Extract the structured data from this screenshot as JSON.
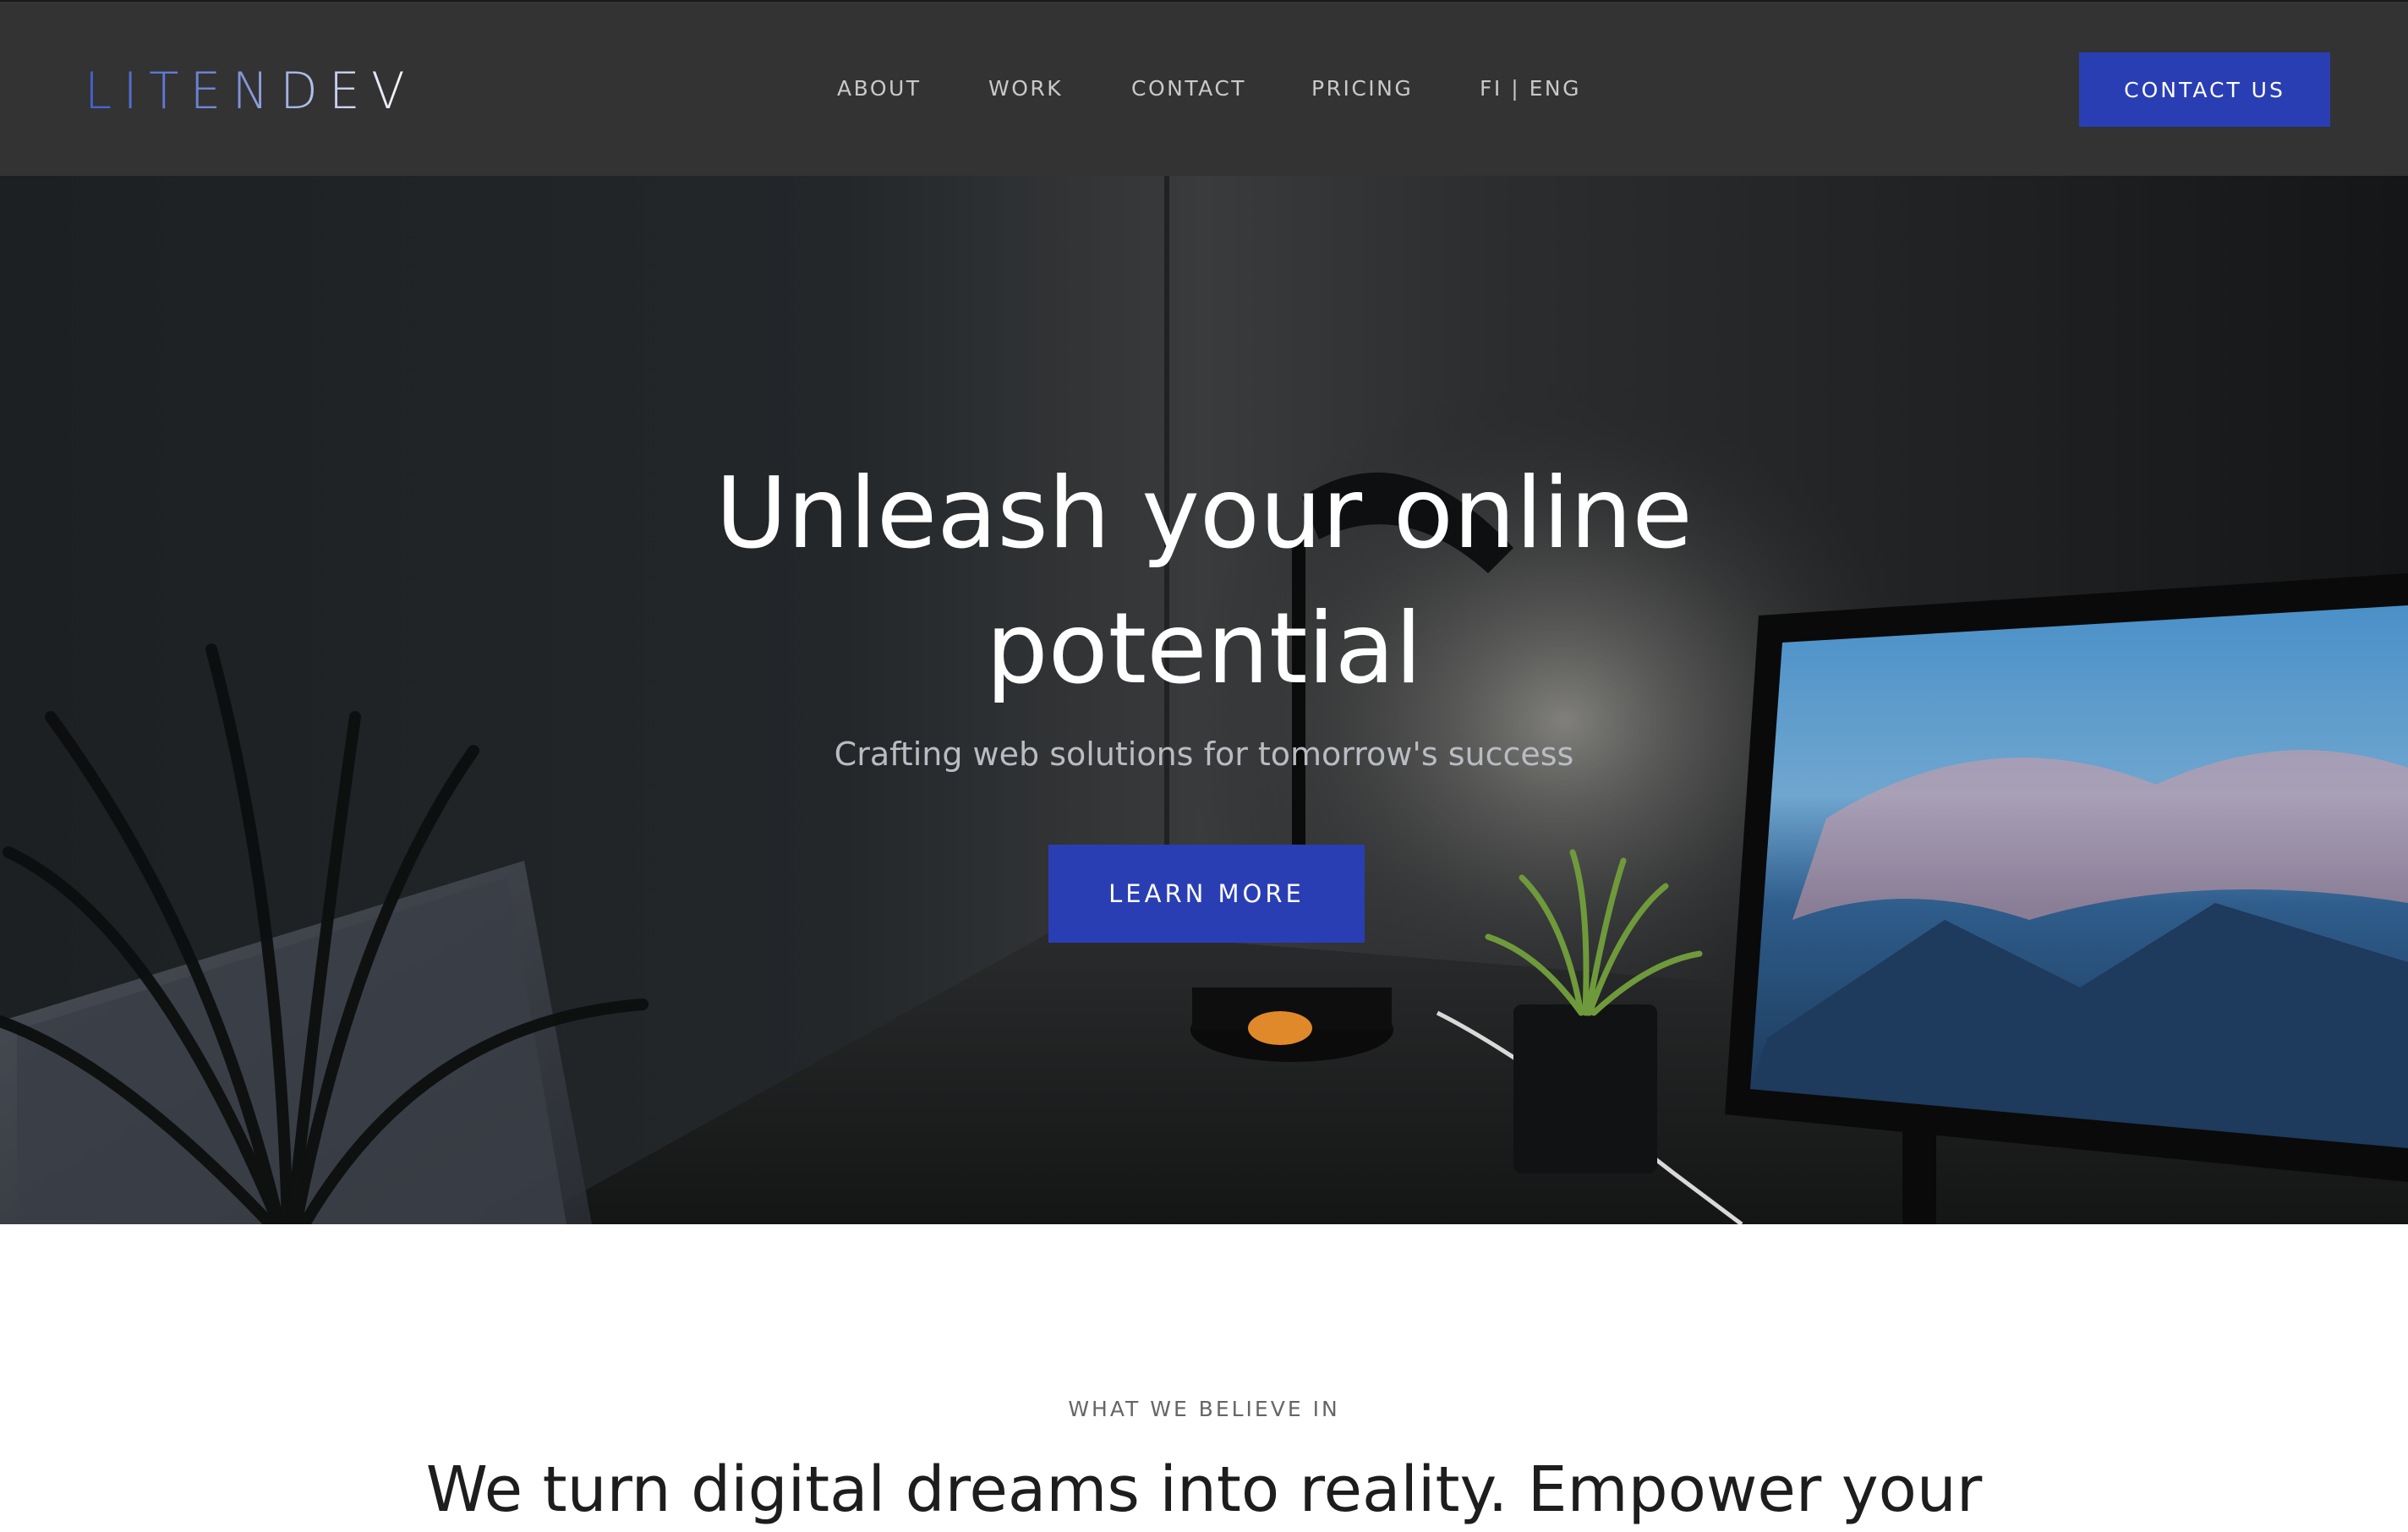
{
  "brand": {
    "logo_text": "LITENDEV",
    "colors": {
      "accent": "#2a3eb4",
      "header_bg": "#333333",
      "nav_text": "#c9c9c9",
      "logo_gradient_start": "#3f5fcf",
      "logo_gradient_end": "#ffffff"
    }
  },
  "nav": {
    "items": [
      {
        "label": "ABOUT"
      },
      {
        "label": "WORK"
      },
      {
        "label": "CONTACT"
      },
      {
        "label": "PRICING"
      },
      {
        "label": "FI | ENG"
      }
    ],
    "cta_label": "CONTACT US"
  },
  "hero": {
    "title_line1": "Unleash your online",
    "title_line2": "potential",
    "subtitle": "Crafting web solutions for tomorrow's success",
    "cta_label": "LEARN MORE"
  },
  "belief": {
    "eyebrow": "WHAT WE BELIEVE IN",
    "heading": "We turn digital dreams into reality. Empower your"
  }
}
